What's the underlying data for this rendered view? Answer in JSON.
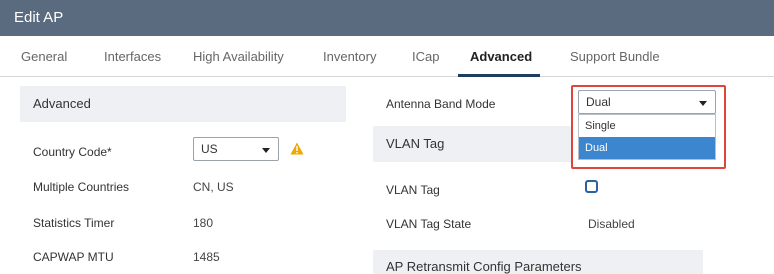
{
  "window": {
    "title": "Edit AP"
  },
  "tabs": [
    {
      "label": "General"
    },
    {
      "label": "Interfaces"
    },
    {
      "label": "High Availability"
    },
    {
      "label": "Inventory"
    },
    {
      "label": "ICap"
    },
    {
      "label": "Advanced"
    },
    {
      "label": "Support Bundle"
    }
  ],
  "active_tab": "Advanced",
  "left_panel": {
    "header": "Advanced",
    "country_code": {
      "label": "Country Code*",
      "value": "US"
    },
    "multiple_countries": {
      "label": "Multiple Countries",
      "value": "CN, US"
    },
    "statistics_timer": {
      "label": "Statistics Timer",
      "value": "180"
    },
    "capwap_mtu": {
      "label": "CAPWAP MTU",
      "value": "1485"
    }
  },
  "right_panel": {
    "antenna_band_mode": {
      "label": "Antenna Band Mode",
      "value": "Dual",
      "options": [
        "Single",
        "Dual"
      ],
      "selected_option": "Dual"
    },
    "vlan_section": {
      "header": "VLAN Tag",
      "vlan_tag": {
        "label": "VLAN Tag",
        "checked": false
      },
      "vlan_tag_state": {
        "label": "VLAN Tag State",
        "value": "Disabled"
      }
    },
    "retransmit_header": "AP Retransmit Config Parameters"
  },
  "colors": {
    "titlebar": "#5a6b80",
    "highlight_border": "#e0443a",
    "selected_option": "#3b86cf",
    "warning": "#f0a800",
    "checkbox": "#2f5f9e"
  },
  "icons": {
    "warning": "warning-triangle-icon",
    "dropdown": "chevron-down-icon"
  }
}
